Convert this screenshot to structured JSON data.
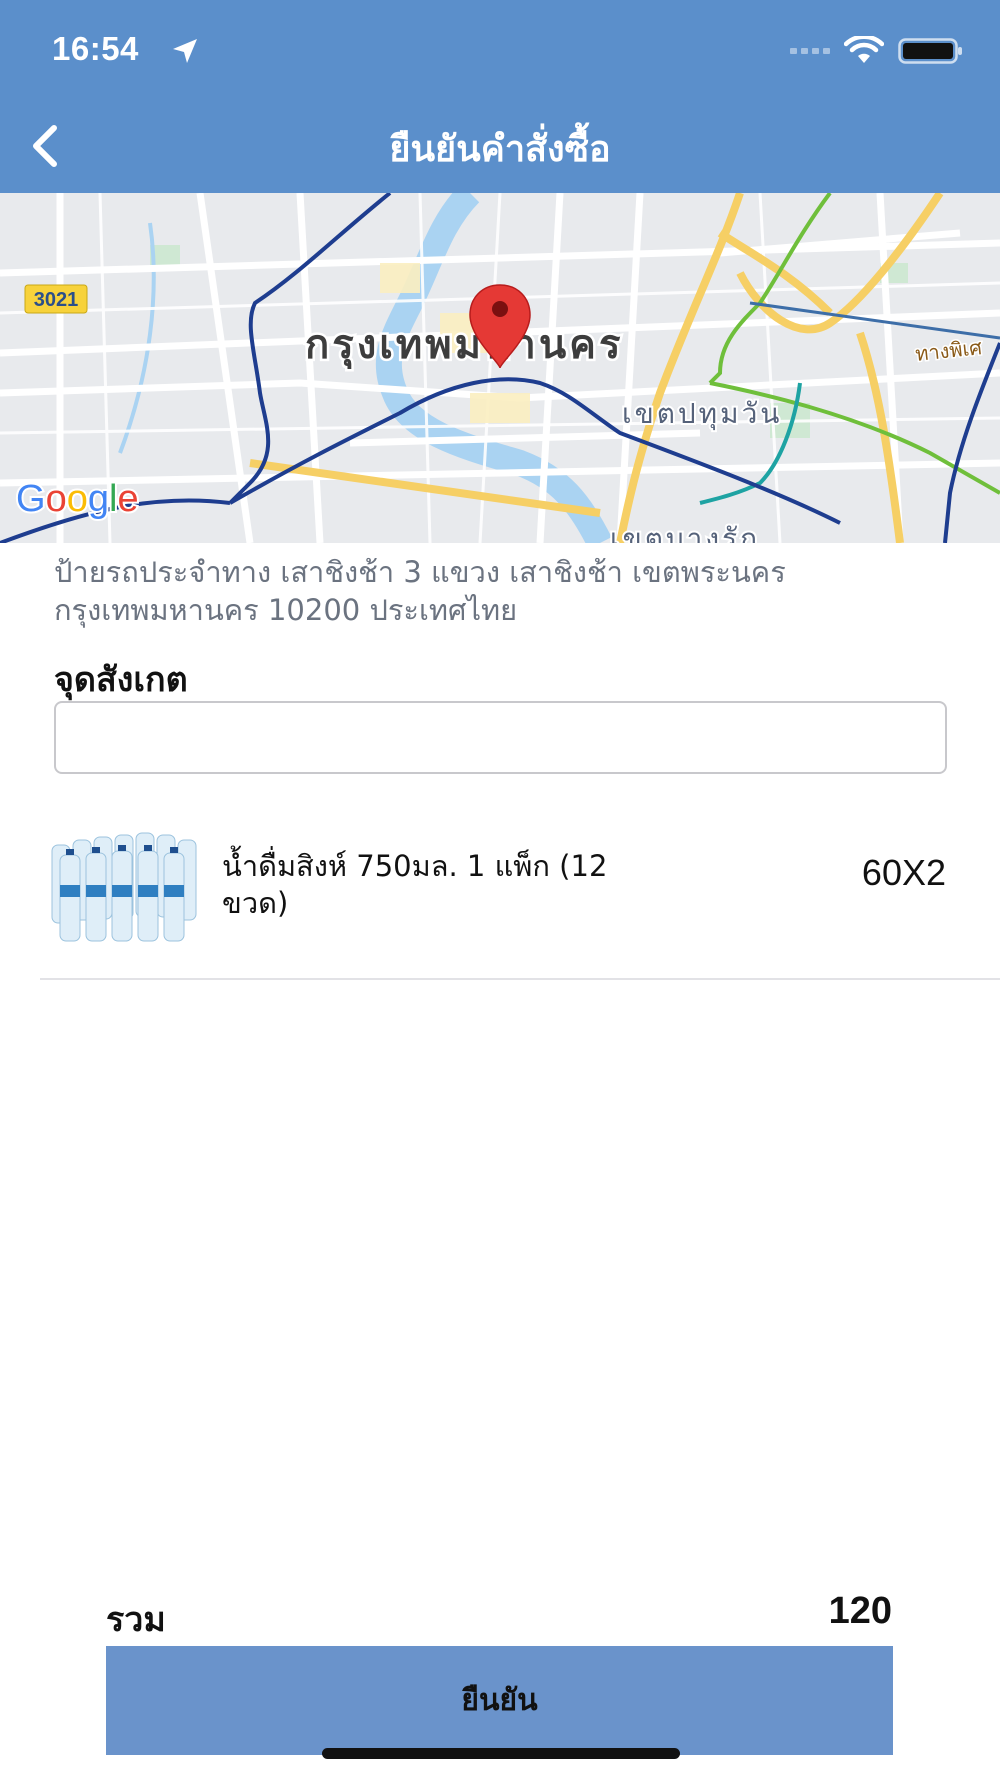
{
  "status_bar": {
    "time": "16:54"
  },
  "header": {
    "title": "ยืนยันคำสั่งซื้อ"
  },
  "map": {
    "city_label": "กรุงเทพมหานคร",
    "district_label": "เขตปทุมวัน",
    "district_label_2": "เขตบางรัก",
    "road_label": "ทางพิเศ",
    "route_shield": "3021",
    "google_logo": "Google",
    "marker_icon": "map-pin-icon"
  },
  "address": "ป้ายรถประจำทาง เสาชิงช้า 3 แขวง เสาชิงช้า เขตพระนคร กรุงเทพมหานคร 10200 ประเทศไทย",
  "landmark": {
    "label": "จุดสังเกต",
    "value": "",
    "placeholder": ""
  },
  "items": [
    {
      "name": "น้ำดื่มสิงห์ 750มล. 1 แพ็ก (12 ขวด)",
      "qty": "60X2"
    }
  ],
  "total": {
    "label": "รวม",
    "value": "120"
  },
  "confirm_button": {
    "label": "ยืนยัน"
  },
  "colors": {
    "header": "#5b8fcb",
    "button": "#6a93cb",
    "marker": "#e53935"
  }
}
